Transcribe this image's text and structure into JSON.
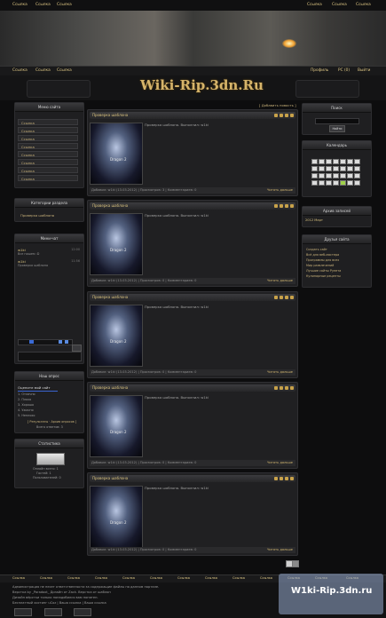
{
  "top_nav_left": [
    "Ссылка",
    "Ссылка",
    "Ссылка"
  ],
  "top_nav_right": [
    "Ссылка",
    "Ссылка",
    "Ссылка"
  ],
  "sub_nav_left": [
    "Ссылка",
    "Ссылка",
    "Ссылка"
  ],
  "sub_nav_right": [
    "Профиль",
    "PC (0)",
    "Выйти"
  ],
  "logo": "Wiki-Rip.3dn.Ru",
  "left_sidebar": {
    "menu_title": "Меню сайта",
    "menu_items": [
      "Ссылка",
      "Ссылка",
      "Ссылка",
      "Ссылка",
      "Ссылка",
      "Ссылка",
      "Ссылка",
      "Ссылка"
    ],
    "categories_title": "Категории раздела",
    "categories": [
      "Проверка шаблона"
    ],
    "minichat_title": "Мини-чат",
    "chat_messages": [
      {
        "user": "w1ki",
        "text": "Все пишем :D",
        "time": "12:00"
      },
      {
        "user": "w1ki",
        "text": "Проверка шаблона",
        "time": "11:56"
      }
    ],
    "poll_title": "Наш опрос",
    "poll_question": "Оцените мой сайт",
    "poll_options": [
      "1. Отлично",
      "2. Плохо",
      "3. Хорошо",
      "4. Ужасно",
      "5. Неплохо"
    ],
    "poll_links": "[ Результаты · Архив опросов ]",
    "poll_total": "Всего ответов: 3",
    "stats_title": "Статистика",
    "online_lines": [
      "Онлайн всего: 1",
      "Гостей: 1",
      "Пользователей: 0"
    ]
  },
  "posts": [
    {
      "title": "Проверка шаблона",
      "desc": "Проверка шаблона. Выполнил: w1ki",
      "thumb": "Dragon 2",
      "footer": "Добавил: w1ki (13.03.2012) | Просмотров: 3 | Комментариев: 0",
      "more": "Читать дальше"
    },
    {
      "title": "Проверка шаблона",
      "desc": "Проверка шаблона. Выполнил: w1ki",
      "thumb": "Dragon 2",
      "footer": "Добавил: w1ki (13.03.2012) | Просмотров: 0 | Комментариев: 0",
      "more": "Читать дальше"
    },
    {
      "title": "Проверка шаблона",
      "desc": "Проверка шаблона. Выполнил: w1ki",
      "thumb": "Dragon 2",
      "footer": "Добавил: w1ki (13.03.2012) | Просмотров: 0 | Комментариев: 0",
      "more": "Читать дальше"
    },
    {
      "title": "Проверка шаблона",
      "desc": "Проверка шаблона. Выполнил: w1ki",
      "thumb": "Dragon 2",
      "footer": "Добавил: w1ki (13.03.2012) | Просмотров: 0 | Комментариев: 0",
      "more": "Читать дальше"
    },
    {
      "title": "Проверка шаблона",
      "desc": "Проверка шаблона. Выполнил: w1ki",
      "thumb": "Dragon 2",
      "footer": "Добавил: w1ki (13.03.2012) | Просмотров: 0 | Комментариев: 0",
      "more": "Читать дальше"
    }
  ],
  "add_news": "[ Добавить новость ]",
  "right_sidebar": {
    "search_title": "Поиск",
    "search_button": "Найти",
    "calendar_title": "Календарь",
    "archive_title": "Архив записей",
    "archive_item": "2012 Март",
    "friends_title": "Друзья сайта",
    "friends": [
      "Создать сайт",
      "Всё для веб-мастера",
      "Программы для всех",
      "Мир развлечений",
      "Лучшие сайты Рунета",
      "Кулинарные рецепты"
    ]
  },
  "footer_links": [
    "Ссылка",
    "Ссылка",
    "Ссылка",
    "Ссылка",
    "Ссылка",
    "Ссылка",
    "Ссылка",
    "Ссылка",
    "Ссылка",
    "Ссылка",
    "Ссылка",
    "Ссылка",
    "Ссылка"
  ],
  "footer_text": [
    "Администрация не несет ответственности за содержащие файлы на данном портале.",
    "Верстка by _Paradoxt_ Дизайн от Zack. Верстка от шаблон",
    "Дизайн вёрстки только понадобился вам понятен.",
    "Бесплатный хостинг uCoz | Ваша ссылка | Ваша ссылка"
  ],
  "watermark": "W1ki-Rip.3dn.ru",
  "colors": {
    "accent": "#d9c27e",
    "bg": "#0d0d0e",
    "panel": "#1f1f21"
  }
}
